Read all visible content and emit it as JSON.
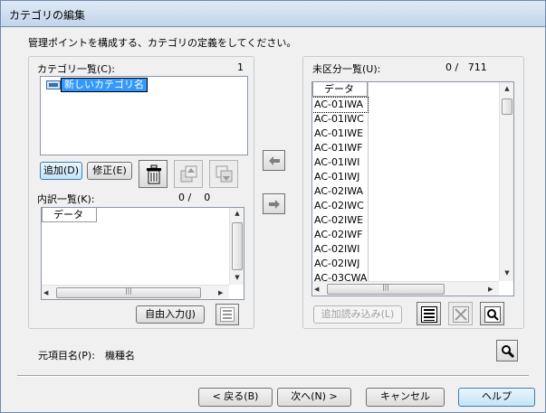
{
  "window": {
    "title": "カテゴリの編集"
  },
  "description": "管理ポイントを構成する、カテゴリの定義をしてください。",
  "category_panel": {
    "label": "カテゴリ一覧(C):",
    "count": "1",
    "items": [
      "新しいカテゴリ名"
    ],
    "add_button": "追加(D)",
    "edit_button": "修正(E)"
  },
  "breakdown_panel": {
    "label": "内訳一覧(K):",
    "count": "0 /    0",
    "column_header": "データ",
    "free_input_button": "自由入力(J)"
  },
  "uncategorized_panel": {
    "label": "未区分一覧(U):",
    "count": "0 /   711",
    "column_header": "データ",
    "items": [
      "AC-01IWA",
      "AC-01IWC",
      "AC-01IWE",
      "AC-01IWF",
      "AC-01IWI",
      "AC-01IWJ",
      "AC-02IWA",
      "AC-02IWC",
      "AC-02IWE",
      "AC-02IWF",
      "AC-02IWI",
      "AC-02IWJ",
      "AC-03CWA"
    ],
    "add_read_button": "追加読み込み(L)"
  },
  "source_item": {
    "label": "元項目名(P):",
    "value": "機種名"
  },
  "footer": {
    "back": "< 戻る(B)",
    "next": "次へ(N) >",
    "cancel": "キャンセル",
    "help": "ヘルプ"
  },
  "icons": [
    "trash-icon",
    "move-up-icon",
    "move-down-icon",
    "arrow-left-icon",
    "arrow-right-icon",
    "list-icon",
    "delete-list-icon",
    "search-icon",
    "zoom-icon"
  ]
}
